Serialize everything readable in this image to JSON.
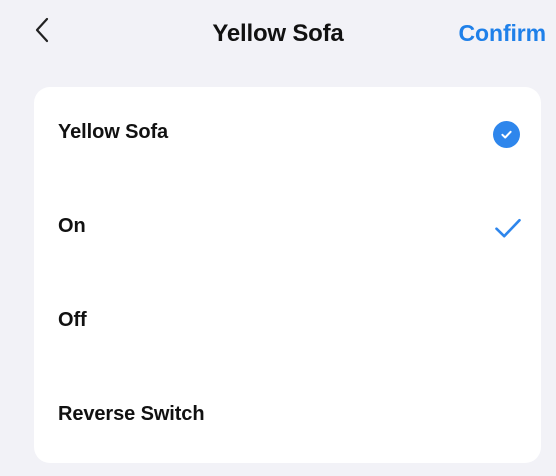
{
  "header": {
    "title": "Yellow Sofa",
    "confirm_label": "Confirm",
    "back_icon": "chevron-left-icon"
  },
  "options": [
    {
      "label": "Yellow Sofa",
      "indicator": "filled-circle-check-icon",
      "selected": true
    },
    {
      "label": "On",
      "indicator": "checkmark-icon",
      "selected": true
    },
    {
      "label": "Off",
      "selected": false
    },
    {
      "label": "Reverse Switch",
      "selected": false
    }
  ],
  "colors": {
    "background": "#f2f2f7",
    "card": "#ffffff",
    "accent": "#1f80e9",
    "text": "#111111"
  }
}
